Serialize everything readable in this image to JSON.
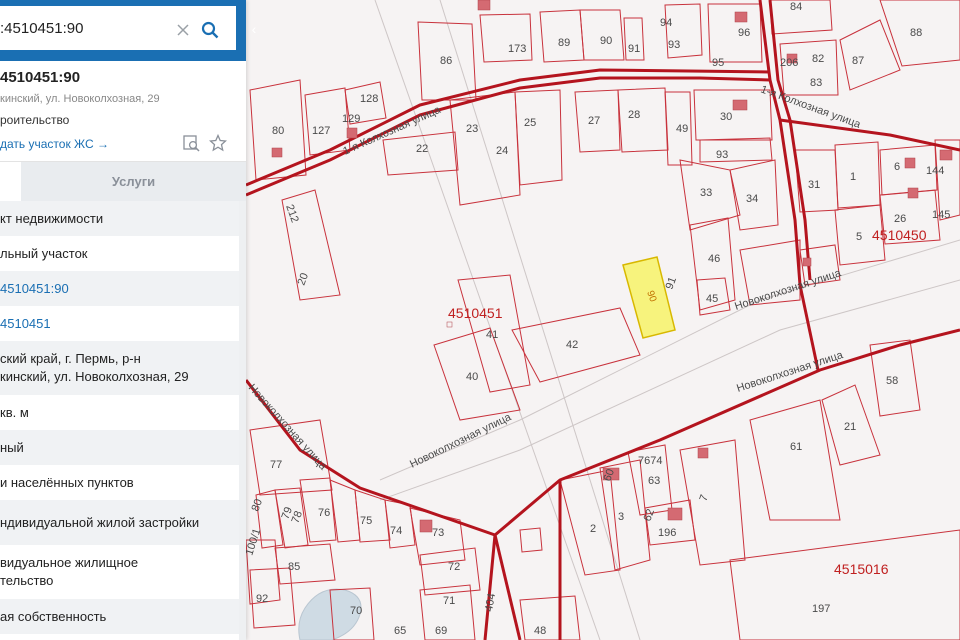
{
  "search": {
    "value": ":4510451:90",
    "clear_icon": "close-icon",
    "search_icon": "search-icon"
  },
  "collapse": {
    "label": "‹"
  },
  "object": {
    "title": "4510451:90",
    "address": "кинский, ул. Новоколхозная, 29",
    "status": "роительство",
    "link": "дать участок ЖС →"
  },
  "tabs": {
    "services": "Услуги"
  },
  "rows": [
    {
      "text": "кт недвижимости",
      "style": "alt"
    },
    {
      "text": "льный участок",
      "style": ""
    },
    {
      "text": "4510451:90",
      "style": "alt link"
    },
    {
      "text": "4510451",
      "style": "link"
    },
    {
      "text": "ский край, г. Пермь, р-н\nкинский, ул. Новоколхозная, 29",
      "style": "alt multi"
    },
    {
      "text": "кв. м",
      "style": ""
    },
    {
      "text": "ный",
      "style": "alt"
    },
    {
      "text": "и населённых пунктов",
      "style": ""
    },
    {
      "text": "ндивидуальной жилой застройки",
      "style": "alt"
    },
    {
      "text": "видуальное жилищное\nтельство",
      "style": "multi"
    },
    {
      "text": "ая собственность",
      "style": "alt"
    }
  ],
  "map": {
    "colors": {
      "boundary": "#c8323c",
      "road": "#b4141e",
      "highlight": "#f7f37d",
      "water": "#cfdbe4"
    },
    "quarter_labels": [
      "4510451",
      "4510450",
      "4515016"
    ],
    "street_labels": [
      "1-я Колхозная улица",
      "1-я Колхозная улица",
      "Новоколхозная улица",
      "Новоколхозная улица",
      "Новоколхозная улица",
      "Новоколхозная улица"
    ],
    "parcel_labels": [
      "173",
      "89",
      "90",
      "91",
      "94",
      "93",
      "95",
      "96",
      "84",
      "206",
      "82",
      "83",
      "87",
      "88",
      "86",
      "128",
      "129",
      "127",
      "80",
      "23",
      "25",
      "27",
      "28",
      "49",
      "30",
      "22",
      "24",
      "93",
      "212",
      "33",
      "34",
      "31",
      "1",
      "6",
      "144",
      "26",
      "145",
      "5",
      "20",
      "46",
      "91",
      "45",
      "41",
      "42",
      "40",
      "58",
      "21",
      "61",
      "77",
      "80",
      "79",
      "78",
      "76",
      "75",
      "74",
      "73",
      "60",
      "7674",
      "63",
      "62",
      "196",
      "7",
      "2",
      "3",
      "100/1",
      "85",
      "72",
      "92",
      "70",
      "71",
      "69",
      "65",
      "404",
      "48",
      "197"
    ],
    "highlight_label": "90"
  }
}
